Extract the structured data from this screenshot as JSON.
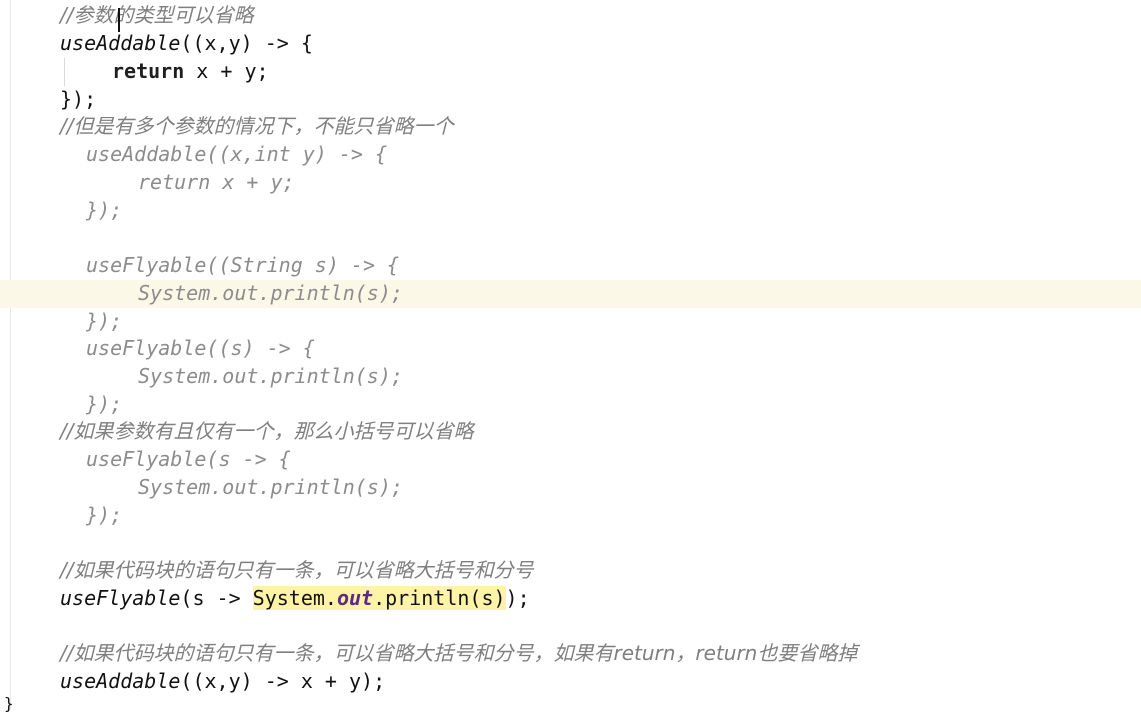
{
  "code": {
    "l1": "//参数的类型可以省略",
    "l2_method": "useAddable",
    "l2_rest": "((x,y) -> {",
    "l3_kw": "return",
    "l3_rest": " x + y;",
    "l4": "});",
    "l5": "//但是有多个参数的情况下，不能只省略一个",
    "l6": "useAddable((x,int y) -> {",
    "l7": "return x + y;",
    "l8": "});",
    "l9": "useFlyable((String s) -> {",
    "l10": "System.out.println(s);",
    "l11": "});",
    "l12": "useFlyable((s) -> {",
    "l13": "System.out.println(s);",
    "l14": "});",
    "l15": "//如果参数有且仅有一个，那么小括号可以省略",
    "l16": "useFlyable(s -> {",
    "l17": "System.out.println(s);",
    "l18": "});",
    "l19": "//如果代码块的语句只有一条，可以省略大括号和分号",
    "l20_method": "useFlyable",
    "l20_a": "(s -> ",
    "l20_sys": "System.",
    "l20_out": "out",
    "l20_println": ".println(s)",
    "l20_end": ");",
    "l21": "//如果代码块的语句只有一条，可以省略大括号和分号，如果有return，return也要省略掉",
    "l22_method": "useAddable",
    "l22_rest": "((x,y) -> x + y);",
    "l23": "}"
  }
}
